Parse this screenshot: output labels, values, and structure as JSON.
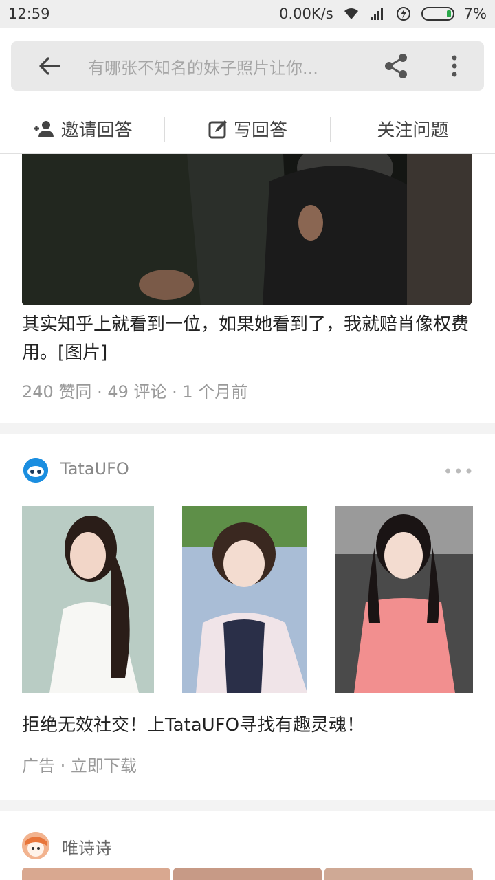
{
  "status_bar": {
    "time": "12:59",
    "network_speed": "0.00K/s",
    "battery_percent": "7%"
  },
  "header": {
    "search_placeholder": "有哪张不知名的妹子照片让你..."
  },
  "actions": [
    {
      "label": "邀请回答"
    },
    {
      "label": "写回答"
    },
    {
      "label": "关注问题"
    }
  ],
  "answer": {
    "text": "其实知乎上就看到一位，如果她看到了，我就赔肖像权费用。[图片]",
    "meta": "240 赞同 · 49 评论 · 1 个月前"
  },
  "ad": {
    "name": "TataUFO",
    "more": "•••",
    "title": "拒绝无效社交！上TataUFO寻找有趣灵魂！",
    "meta": "广告 · 立即下载"
  },
  "next_post": {
    "name": "唯诗诗"
  }
}
